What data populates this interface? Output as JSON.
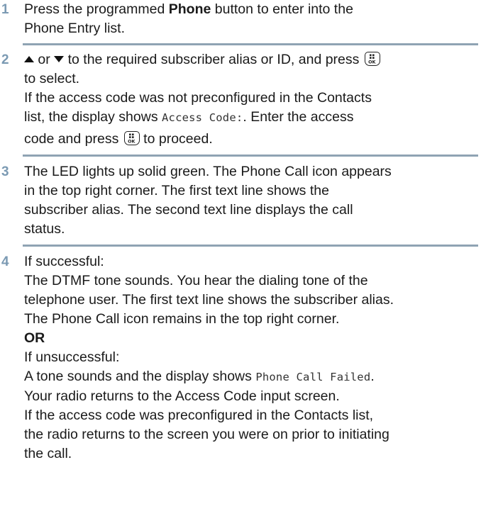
{
  "steps": [
    {
      "num": "1",
      "text_a": "Press the programmed ",
      "text_bold": "Phone",
      "text_b": " button to enter into the",
      "text_c": "Phone Entry list."
    },
    {
      "num": "2",
      "or": " or ",
      "line1": " to the required subscriber alias or ID, and press ",
      "line2": "to select.",
      "line3": "If the access code was not preconfigured in the Contacts",
      "line4_a": "list, the display shows ",
      "line4_code": "Access Code:",
      "line4_b": ". Enter the access",
      "line5_a": "code and press ",
      "line5_b": " to proceed."
    },
    {
      "num": "3",
      "line1": "The LED lights up solid green. The Phone Call icon appears",
      "line2": "in the top right corner. The first text line shows the",
      "line3": "subscriber alias. The second text line displays the call",
      "line4": "status."
    },
    {
      "num": "4",
      "line1": "If successful:",
      "line2": "The DTMF tone sounds. You hear the dialing tone of the",
      "line3": "telephone user. The first text line shows the subscriber alias.",
      "line4": "The Phone Call icon remains in the top right corner.",
      "or_label": "OR",
      "line5": "If unsuccessful:",
      "line6_a": "A tone sounds and the display shows ",
      "line6_code": "Phone Call Failed",
      "line6_b": ".",
      "line7": "Your radio returns to the Access Code input screen.",
      "line8": "If the access code was preconfigured in the Contacts list,",
      "line9": "the radio returns to the screen you were on prior to initiating",
      "line10": "the call."
    }
  ],
  "icons": {
    "up": "up-arrow-key-icon",
    "down": "down-arrow-key-icon",
    "ok": "menu-ok-button-icon"
  },
  "colors": {
    "step_number": "#7b9ab3",
    "separator": "#8fa3b3",
    "text": "#1a1a1a"
  }
}
